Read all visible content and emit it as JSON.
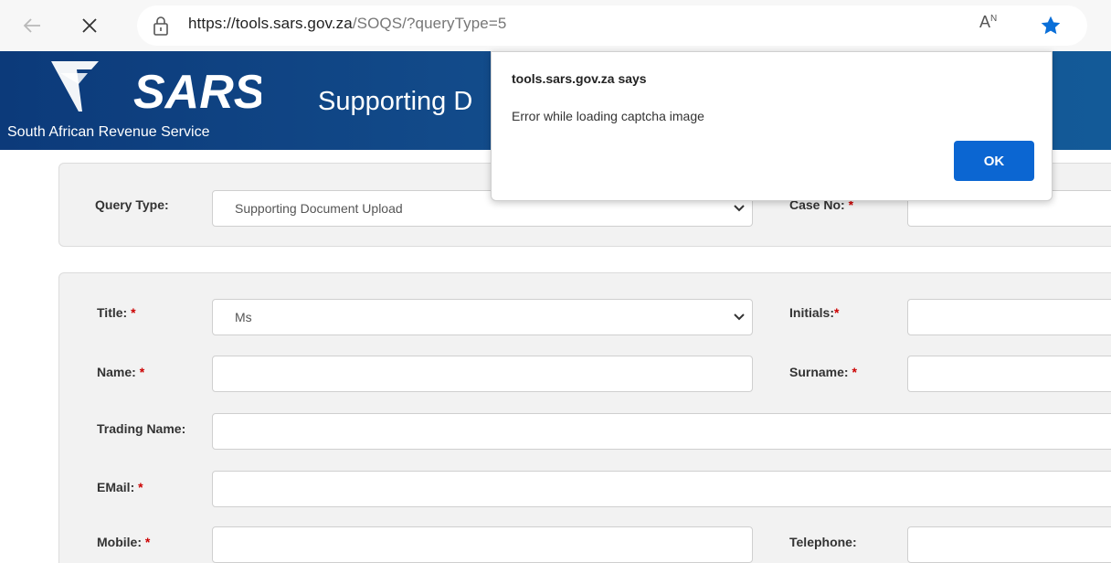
{
  "browser": {
    "url_host": "https://tools.sars.gov.za",
    "url_path": "/SOQS/?queryType=5",
    "read_aloud": "A",
    "read_aloud_sup": "N"
  },
  "header": {
    "logo_text": "SARS",
    "subtitle": "South African Revenue Service",
    "title": "Supporting D"
  },
  "query": {
    "type_label": "Query Type:",
    "type_value": "Supporting Document Upload",
    "case_label": "Case No:",
    "case_req": "*"
  },
  "form": {
    "title_label": "Title:",
    "title_value": "Ms",
    "initials_label": "Initials:",
    "name_label": "Name:",
    "surname_label": "Surname:",
    "trading_label": "Trading Name:",
    "email_label": "EMail:",
    "mobile_label": "Mobile:",
    "telephone_label": "Telephone:",
    "req": "*"
  },
  "dialog": {
    "title": "tools.sars.gov.za says",
    "message": "Error while loading captcha image",
    "ok_label": "OK"
  },
  "colors": {
    "header_blue": "#14508f",
    "ok_blue": "#0b66d2",
    "star_blue": "#0a6fd8",
    "required_red": "#cc0000"
  },
  "icons": [
    "back-arrow-icon",
    "close-icon",
    "lock-icon",
    "read-aloud-icon",
    "favorite-star-icon",
    "chevron-down-icon"
  ]
}
